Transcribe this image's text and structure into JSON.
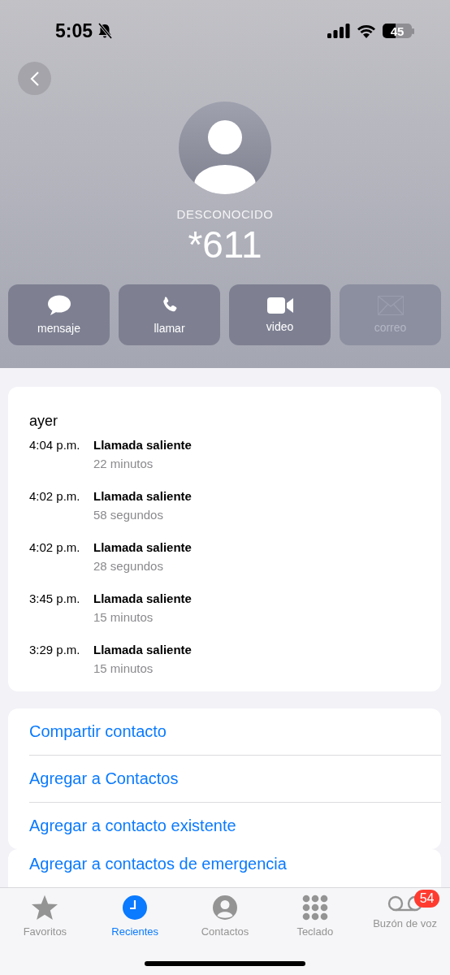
{
  "status_bar": {
    "time": "5:05",
    "silent": true,
    "battery": "45"
  },
  "contact": {
    "label": "DESCONOCIDO",
    "number": "*611"
  },
  "actions": [
    {
      "label": "mensaje",
      "disabled": false
    },
    {
      "label": "llamar",
      "disabled": false
    },
    {
      "label": "video",
      "disabled": false
    },
    {
      "label": "correo",
      "disabled": true
    }
  ],
  "history": {
    "day": "ayer",
    "calls": [
      {
        "time": "4:04 p.m.",
        "type": "Llamada saliente",
        "duration": "22 minutos"
      },
      {
        "time": "4:02 p.m.",
        "type": "Llamada saliente",
        "duration": "58 segundos"
      },
      {
        "time": "4:02 p.m.",
        "type": "Llamada saliente",
        "duration": "28 segundos"
      },
      {
        "time": "3:45 p.m.",
        "type": "Llamada saliente",
        "duration": "15 minutos"
      },
      {
        "time": "3:29 p.m.",
        "type": "Llamada saliente",
        "duration": "15 minutos"
      }
    ]
  },
  "options": [
    "Compartir contacto",
    "Agregar a Contactos",
    "Agregar a contacto existente"
  ],
  "more_options": [
    "Agregar a contactos de emergencia"
  ],
  "tabs": [
    {
      "label": "Favoritos",
      "selected": false
    },
    {
      "label": "Recientes",
      "selected": true
    },
    {
      "label": "Contactos",
      "selected": false
    },
    {
      "label": "Teclado",
      "selected": false
    },
    {
      "label": "Buzón de voz",
      "selected": false,
      "badge": "54"
    }
  ]
}
